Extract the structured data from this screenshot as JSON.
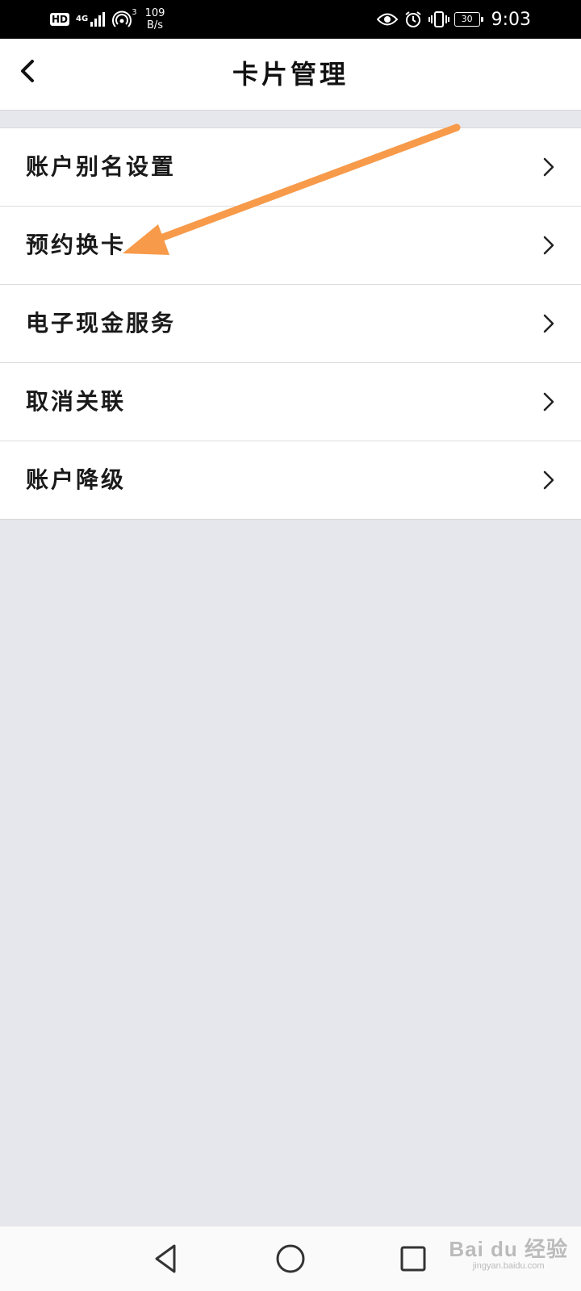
{
  "status_bar": {
    "hd": "HD",
    "network": "4G",
    "hotspot_count": "3",
    "speed_value": "109",
    "speed_unit": "B/s",
    "battery": "30",
    "time": "9:03"
  },
  "header": {
    "title": "卡片管理"
  },
  "menu": {
    "items": [
      {
        "label": "账户别名设置"
      },
      {
        "label": "预约换卡"
      },
      {
        "label": "电子现金服务"
      },
      {
        "label": "取消关联"
      },
      {
        "label": "账户降级"
      }
    ]
  },
  "watermark": {
    "main": "Bai du 经验",
    "sub": "jingyan.baidu.com"
  },
  "colors": {
    "annotation_arrow": "#f79a4a",
    "page_background": "#e6e7ec"
  }
}
